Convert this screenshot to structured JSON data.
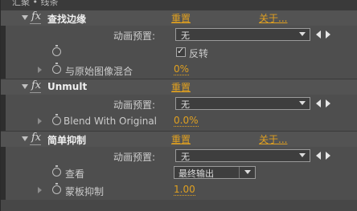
{
  "top_text": "汇聚 • 线条",
  "effects": [
    {
      "name": "查找边缘",
      "reset": "重置",
      "about": "关于...",
      "preset_label": "动画预置:",
      "preset_value": "无",
      "invert_label": "反转",
      "invert_checked": true,
      "blend_label": "与原始图像混合",
      "blend_value": "0%"
    },
    {
      "name": "Unmult",
      "reset": "重置",
      "about": "",
      "preset_label": "动画预置:",
      "preset_value": "无",
      "blend_label": "Blend With Original",
      "blend_value": "0.0%"
    },
    {
      "name": "简单抑制",
      "reset": "重置",
      "about": "关于...",
      "preset_label": "动画预置:",
      "preset_value": "无",
      "view_label": "查看",
      "view_value": "最终输出",
      "matte_label": "蒙板抑制",
      "matte_value": "1.00"
    }
  ],
  "icons": {
    "fx": "fx",
    "checkmark": "✓"
  },
  "colors": {
    "link": "#e0a020",
    "panel": "#4e4e4e"
  }
}
